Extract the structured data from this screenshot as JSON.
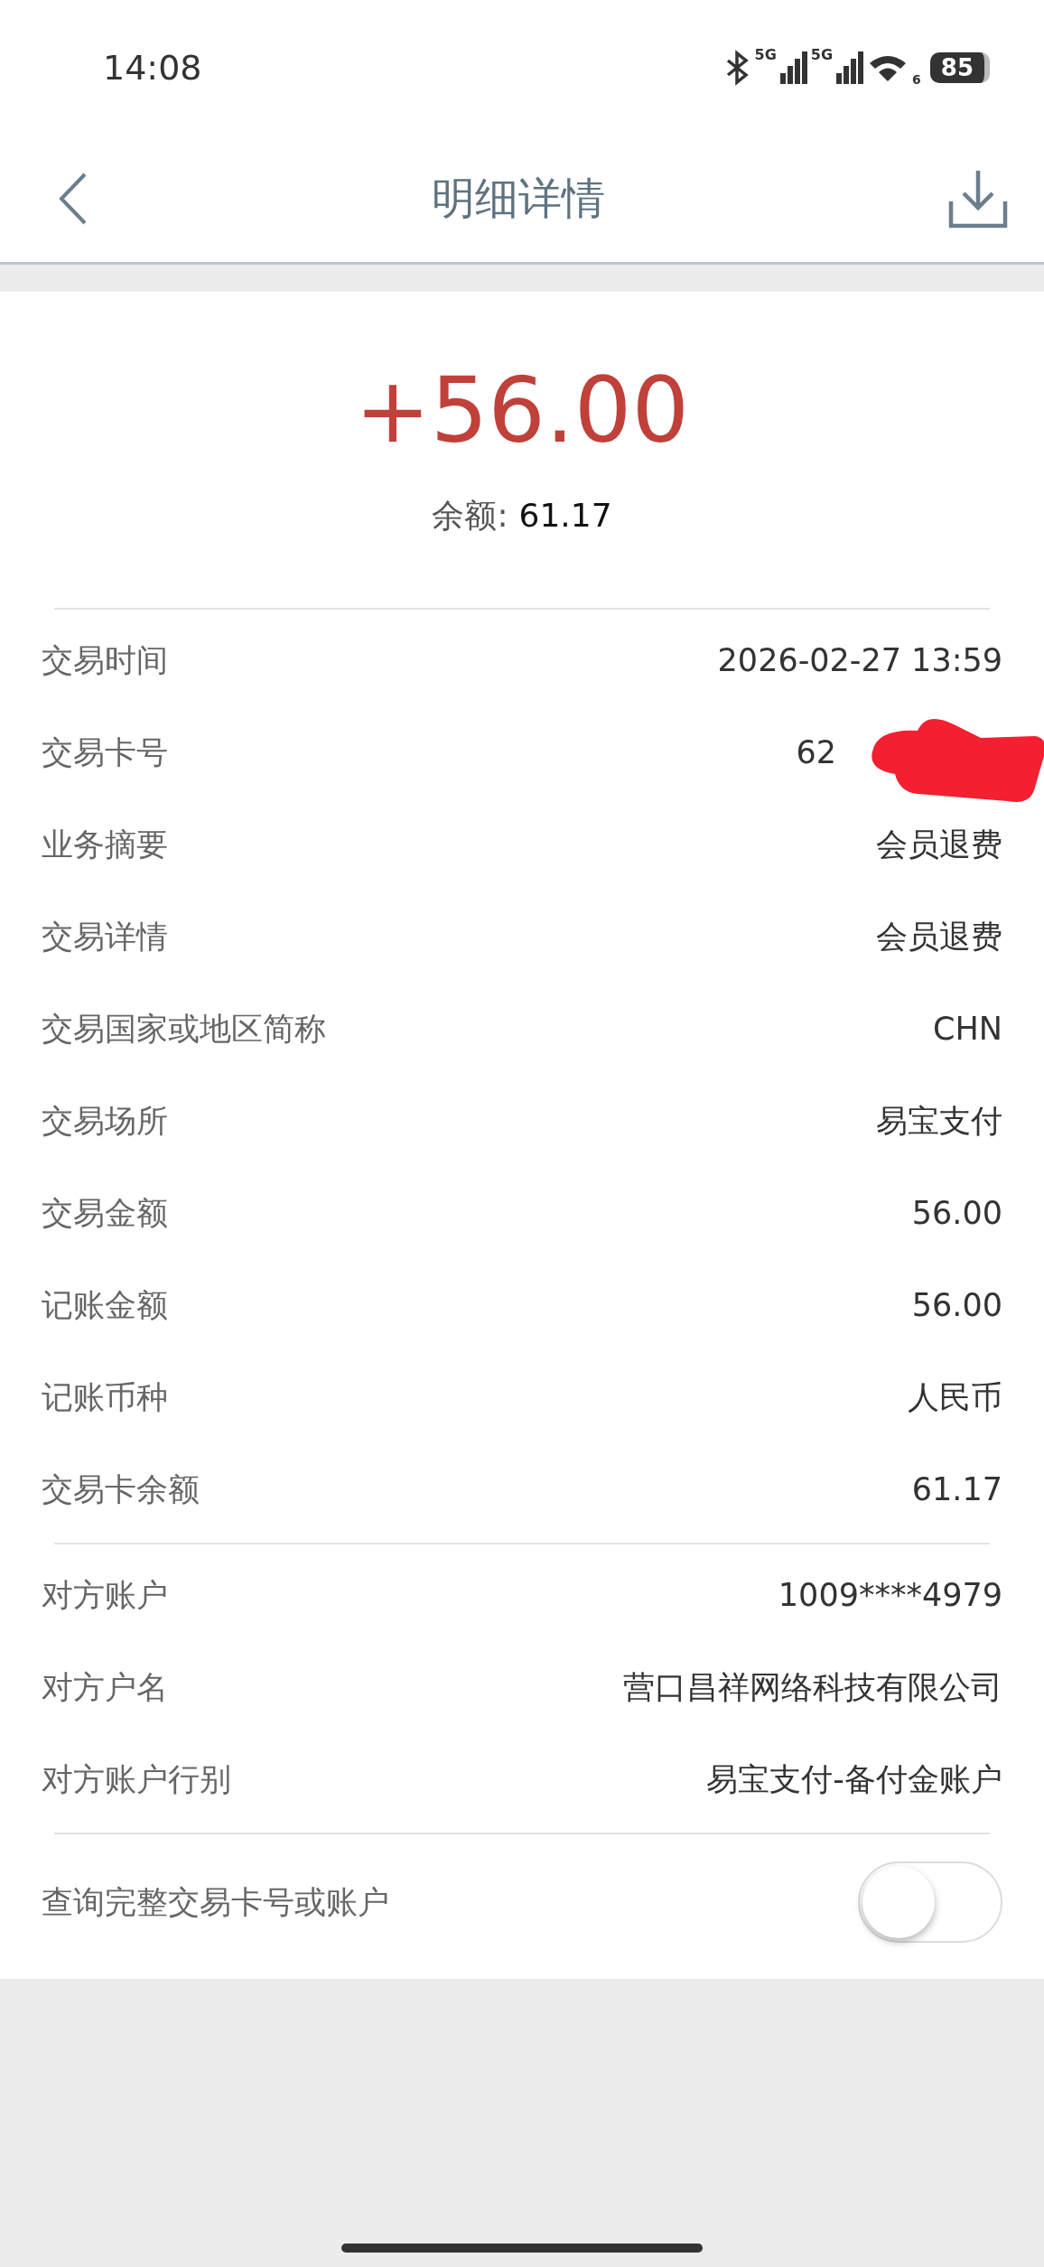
{
  "status_bar": {
    "time": "14:08",
    "sim1": "5G",
    "sim2": "5G",
    "wifi_band": "6",
    "battery": "85"
  },
  "nav": {
    "title": "明细详情"
  },
  "summary": {
    "amount": "+56.00",
    "balance_label": "余额:",
    "balance": "61.17"
  },
  "groups": [
    {
      "rows": [
        {
          "label": "交易时间",
          "value": "2026-02-27 13:59",
          "redacted": false
        },
        {
          "label": "交易卡号",
          "value": "62",
          "redacted": true
        },
        {
          "label": "业务摘要",
          "value": "会员退费",
          "redacted": false
        },
        {
          "label": "交易详情",
          "value": "会员退费",
          "redacted": false
        },
        {
          "label": "交易国家或地区简称",
          "value": "CHN",
          "redacted": false
        },
        {
          "label": "交易场所",
          "value": "易宝支付",
          "redacted": false
        },
        {
          "label": "交易金额",
          "value": "56.00",
          "redacted": false
        },
        {
          "label": "记账金额",
          "value": "56.00",
          "redacted": false
        },
        {
          "label": "记账币种",
          "value": "人民币",
          "redacted": false
        },
        {
          "label": "交易卡余额",
          "value": "61.17",
          "redacted": false
        }
      ]
    },
    {
      "rows": [
        {
          "label": "对方账户",
          "value": "1009****4979",
          "redacted": false
        },
        {
          "label": "对方户名",
          "value": "营口昌祥网络科技有限公司",
          "redacted": false
        },
        {
          "label": "对方账户行别",
          "value": "易宝支付-备付金账户",
          "redacted": false
        }
      ]
    }
  ],
  "toggle": {
    "label": "查询完整交易卡号或账户",
    "on": false
  }
}
